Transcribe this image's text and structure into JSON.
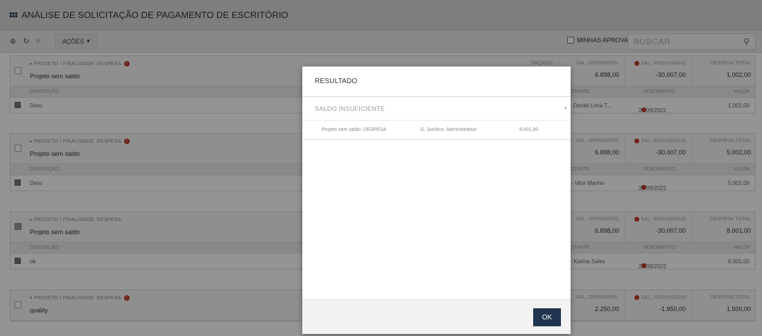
{
  "header": {
    "title": "ANÁLISE DE SOLICITAÇÃO DE PAGAMENTO DE ESCRITÓRIO"
  },
  "toolbar": {
    "add_icon": "⊕",
    "refresh_icon": "↻",
    "filter_icon": "⌕",
    "actions_label": "AÇÕES",
    "actions_caret": "▾",
    "my_approvals_label": "MINHAS APROVAÇÕES",
    "search_placeholder": "BUSCAR"
  },
  "cards": [
    {
      "project_label": "▸ PROJETO / FINALIDADE: DESPESA",
      "name": "Projeto sem saldo",
      "orcado_label": "ORÇADO",
      "disp_label": "SAL. DISPONÍVEL",
      "disp_value": "6.898,00",
      "prov_label": "SAL. PROVISÓRIO",
      "prov_value": "-30.007,00",
      "total_label": "DESPESA TOTAL",
      "total_value": "1.002,00",
      "sub_desc": "DESCRIÇÃO",
      "sub_sol": "LICITANTE",
      "sub_venc": "VENCIMENTO",
      "sub_valor": "VALOR",
      "row_desc": "Desc",
      "row_sol": "T - Daniel Lima T...",
      "row_venc": "29/09/2022",
      "row_valor": "1.002,00"
    },
    {
      "project_label": "▸ PROJETO / FINALIDADE: DESPESA",
      "name": "Projeto sem saldo",
      "disp_label": "SAL. DISPONÍVEL",
      "disp_value": "6.898,00",
      "prov_label": "SAL. PROVISÓRIO",
      "prov_value": "-30.007,00",
      "total_label": "DESPESA TOTAL",
      "total_value": "5.002,00",
      "sub_desc": "DESCRIÇÃO",
      "sub_sol": "LICITANTE",
      "sub_venc": "VENCIMENTO",
      "sub_valor": "VALOR",
      "row_desc": "Desc",
      "row_sol": "M - Vitor Marino",
      "row_venc": "29/09/2022",
      "row_valor": "5.002,00"
    },
    {
      "project_label": "▸ PROJETO / FINALIDADE: DESPESA",
      "name": "Projeto sem saldo",
      "disp_label": "SAL. DISPONÍVEL",
      "disp_value": "6.898,00",
      "prov_label": "SAL. PROVISÓRIO",
      "prov_value": "-30.007,00",
      "total_label": "DESPESA TOTAL",
      "total_value": "8.001,00",
      "sub_desc": "DESCRIÇÃO",
      "sub_sol": "LICITANTE",
      "sub_venc": "VENCIMENTO",
      "sub_valor": "VALOR",
      "row_desc": "ok",
      "row_sol": "S - Karina Sales",
      "row_venc": "23/09/2022",
      "row_valor": "8.001,00"
    },
    {
      "project_label": "▾ PROJETO / FINALIDADE: DESPESA",
      "name": "quality",
      "disp_label": "SAL. DISPONÍVEL",
      "disp_value": "2.250,00",
      "prov_label": "SAL. PROVISÓRIO",
      "prov_value": "-1.950,00",
      "total_label": "DESPESA TOTAL",
      "total_value": "1.500,00"
    }
  ],
  "modal": {
    "title": "RESULTADO",
    "section": "SALDO INSUFICIENTE",
    "row": {
      "project": "Projeto sem saldo: DESPESA",
      "group": "G. Jurídico: Administrativo",
      "value": "8.001,00"
    },
    "ok_label": "OK"
  },
  "colors": {
    "brand": "#1f3550",
    "warning": "#c0392b"
  }
}
